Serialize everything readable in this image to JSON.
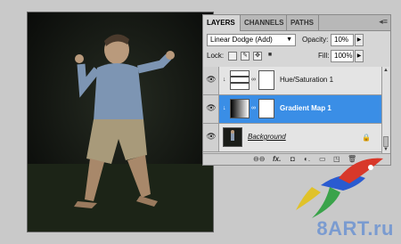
{
  "tabs": [
    "LAYERS",
    "CHANNELS",
    "PATHS"
  ],
  "panel_menu_icon": "panel-menu-icon",
  "blend_mode": "Linear Dodge (Add)",
  "opacity_label": "Opacity:",
  "opacity_value": "10%",
  "lock_label": "Lock:",
  "fill_label": "Fill:",
  "fill_value": "100%",
  "layers": [
    {
      "name": "Hue/Saturation 1",
      "selected": false
    },
    {
      "name": "Gradient Map 1",
      "selected": true
    },
    {
      "name": "Background",
      "selected": false
    }
  ],
  "watermark": "8ART.ru",
  "colors": {
    "selection": "#3a8ee6",
    "watermark": "#7a9bd0"
  }
}
